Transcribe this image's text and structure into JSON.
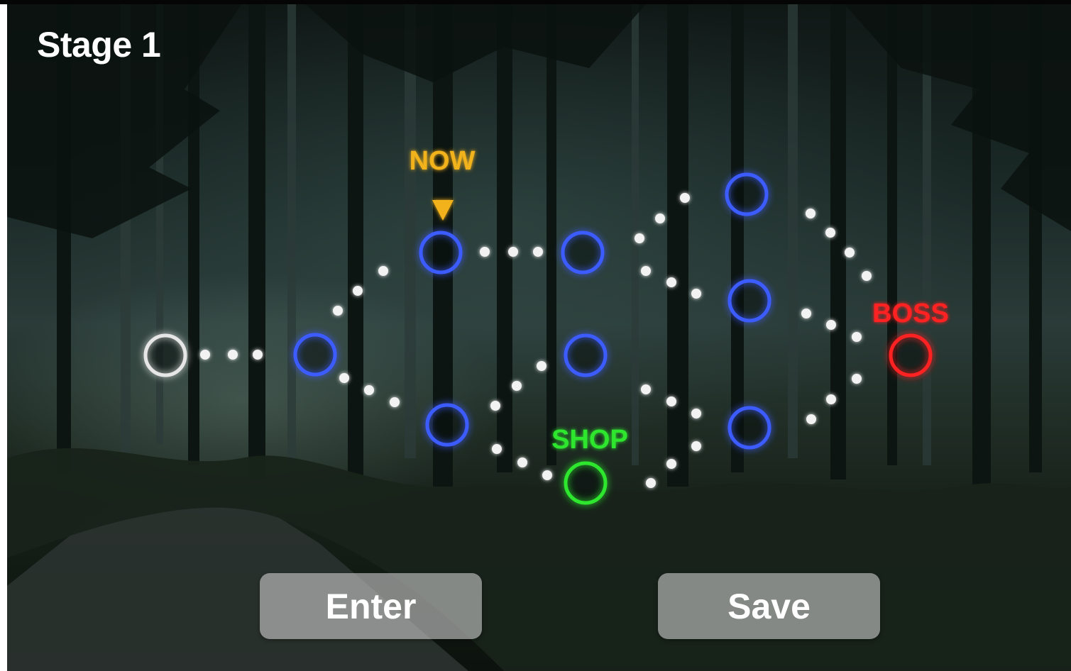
{
  "stage": {
    "title": "Stage 1"
  },
  "buttons": {
    "enter_label": "Enter",
    "save_label": "Save"
  },
  "markers": {
    "now_label": "NOW",
    "shop_label": "SHOP",
    "boss_label": "BOSS"
  },
  "colors": {
    "visited": "#e6e6e6",
    "battle": "#3d5cff",
    "shop": "#2ee62e",
    "boss": "#ff2020",
    "now": "#f2b21f",
    "path_dot": "#f2f2f2"
  },
  "map": {
    "nodes": [
      {
        "id": "start",
        "type": "visited"
      },
      {
        "id": "n1",
        "type": "battle"
      },
      {
        "id": "n2-top",
        "type": "battle",
        "current": true
      },
      {
        "id": "n2-bottom",
        "type": "battle"
      },
      {
        "id": "n3-top",
        "type": "battle"
      },
      {
        "id": "n3-mid",
        "type": "battle"
      },
      {
        "id": "shop",
        "type": "shop"
      },
      {
        "id": "n4-top",
        "type": "battle"
      },
      {
        "id": "n4-mid",
        "type": "battle"
      },
      {
        "id": "n4-bottom",
        "type": "battle"
      },
      {
        "id": "boss",
        "type": "boss"
      }
    ]
  }
}
